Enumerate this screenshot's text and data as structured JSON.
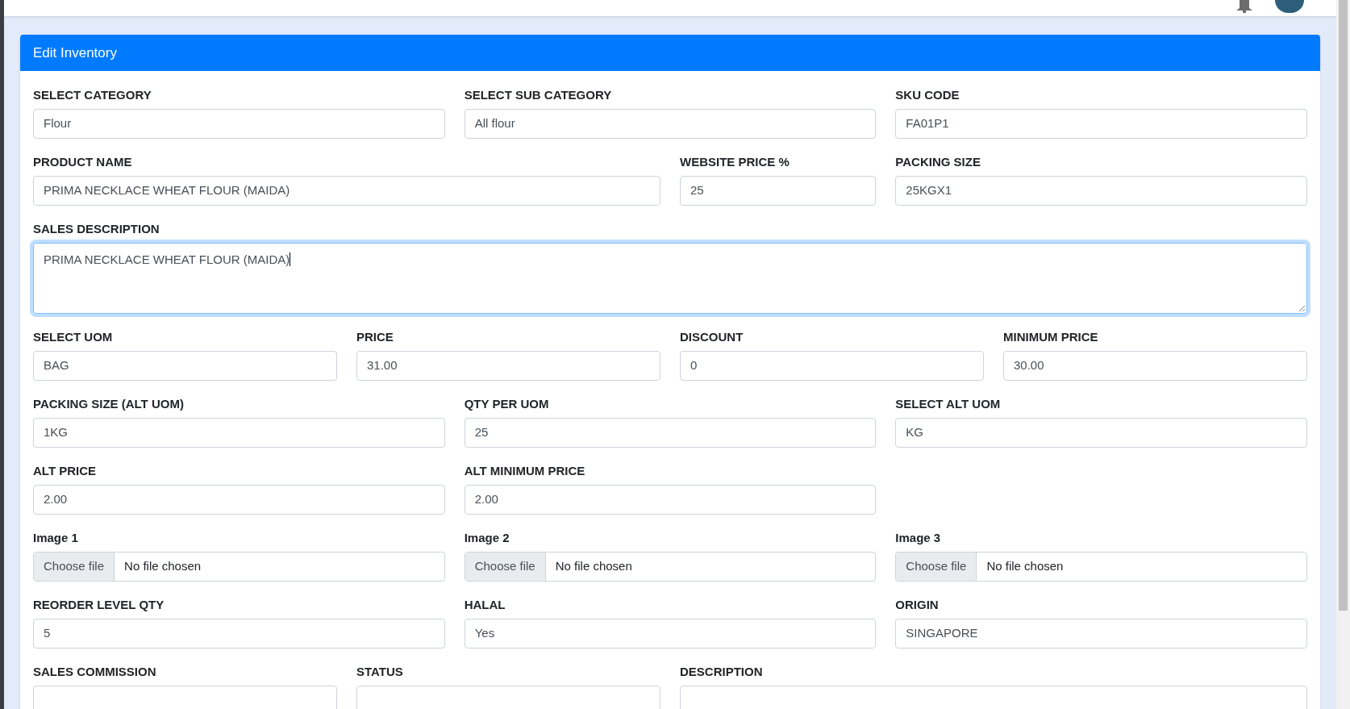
{
  "header": {
    "title": "Edit Inventory"
  },
  "rows": [
    [
      {
        "label": "SELECT CATEGORY",
        "kind": "input",
        "value": "Flour"
      },
      {
        "label": "SELECT SUB CATEGORY",
        "kind": "input",
        "value": "All flour"
      },
      {
        "label": "SKU CODE",
        "kind": "input",
        "value": "FA01P1"
      }
    ],
    [
      {
        "label": "PRODUCT NAME",
        "kind": "input",
        "value": "PRIMA NECKLACE WHEAT FLOUR (MAIDA)"
      },
      {
        "label": "WEBSITE PRICE %",
        "kind": "input",
        "value": "25"
      },
      {
        "label": "PACKING SIZE",
        "kind": "input",
        "value": "25KGX1"
      }
    ],
    [
      {
        "label": "SALES DESCRIPTION",
        "kind": "textarea",
        "value": "PRIMA NECKLACE WHEAT FLOUR (MAIDA)",
        "focused": true
      }
    ],
    [
      {
        "label": "SELECT UOM",
        "kind": "input",
        "value": "BAG"
      },
      {
        "label": "PRICE",
        "kind": "input",
        "value": "31.00"
      },
      {
        "label": "DISCOUNT",
        "kind": "input",
        "value": "0"
      },
      {
        "label": "MINIMUM PRICE",
        "kind": "input",
        "value": "30.00"
      }
    ],
    [
      {
        "label": "PACKING SIZE (ALT UOM)",
        "kind": "input",
        "value": "1KG"
      },
      {
        "label": "QTY PER UOM",
        "kind": "input",
        "value": "25"
      },
      {
        "label": "SELECT ALT UOM",
        "kind": "input",
        "value": "KG"
      }
    ],
    [
      {
        "label": "ALT PRICE",
        "kind": "input",
        "value": "2.00"
      },
      {
        "label": "ALT MINIMUM PRICE",
        "kind": "input",
        "value": "2.00"
      }
    ],
    [
      {
        "label": "Image 1",
        "kind": "file",
        "button": "Choose file",
        "value": "No file chosen"
      },
      {
        "label": "Image 2",
        "kind": "file",
        "button": "Choose file",
        "value": "No file chosen"
      },
      {
        "label": "Image 3",
        "kind": "file",
        "button": "Choose file",
        "value": "No file chosen"
      }
    ],
    [
      {
        "label": "REORDER LEVEL QTY",
        "kind": "input",
        "value": "5"
      },
      {
        "label": "HALAL",
        "kind": "input",
        "value": "Yes"
      },
      {
        "label": "ORIGIN",
        "kind": "input",
        "value": "SINGAPORE"
      }
    ],
    [
      {
        "label": "SALES COMMISSION",
        "kind": "input"
      },
      {
        "label": "STATUS",
        "kind": "input"
      },
      {
        "label": "DESCRIPTION",
        "kind": "input"
      }
    ]
  ]
}
